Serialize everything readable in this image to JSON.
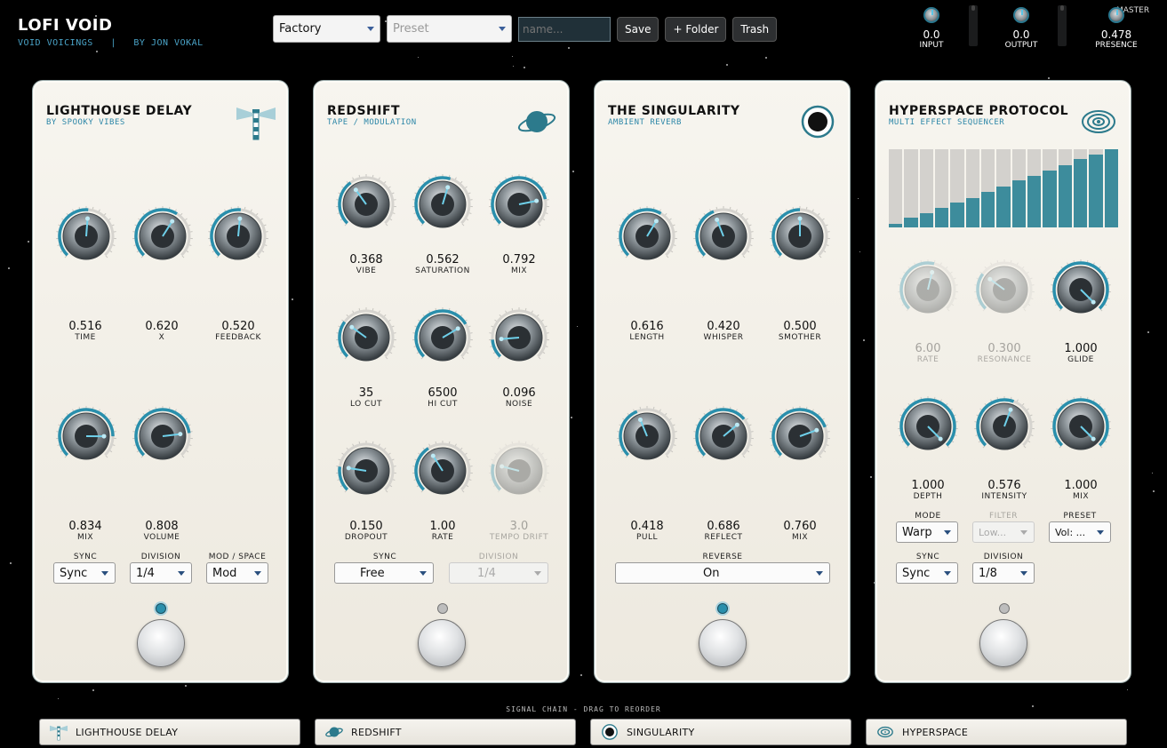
{
  "app": {
    "title": "LOFI VOID",
    "subtitle": "VOID VOICINGS   |   BY JON VOKAL"
  },
  "toolbar": {
    "bank": "Factory",
    "preset_placeholder": "Preset",
    "name_placeholder": "name...",
    "save": "Save",
    "folder": "+ Folder",
    "trash": "Trash"
  },
  "meters": {
    "input": {
      "value": "0.0",
      "label": "INPUT"
    },
    "output": {
      "value": "0.0",
      "label": "OUTPUT"
    },
    "presence": {
      "value": "0.478",
      "label": "PRESENCE"
    },
    "master_label": "MASTER"
  },
  "pedals": [
    {
      "title": "LIGHTHOUSE DELAY",
      "subtitle": "BY SPOOKY VIBES",
      "knobs": [
        {
          "value": "0.516",
          "label": "TIME",
          "level": 0.516
        },
        {
          "value": "0.620",
          "label": "X",
          "level": 0.62
        },
        {
          "value": "0.520",
          "label": "FEEDBACK",
          "level": 0.52
        },
        {
          "value": "0.834",
          "label": "MIX",
          "level": 0.834
        },
        {
          "value": "0.808",
          "label": "VOLUME",
          "level": 0.808
        }
      ],
      "dropdowns": [
        {
          "label": "SYNC",
          "value": "Sync"
        },
        {
          "label": "DIVISION",
          "value": "1/4"
        },
        {
          "label": "MOD / SPACE",
          "value": "Mod"
        }
      ],
      "active": true
    },
    {
      "title": "REDSHIFT",
      "subtitle": "TAPE / MODULATION",
      "knobs": [
        {
          "value": "0.368",
          "label": "VIBE",
          "level": 0.368
        },
        {
          "value": "0.562",
          "label": "SATURATION",
          "level": 0.562
        },
        {
          "value": "0.792",
          "label": "MIX",
          "level": 0.792
        },
        {
          "value": "35",
          "label": "LO CUT",
          "level": 0.3
        },
        {
          "value": "6500",
          "label": "HI CUT",
          "level": 0.72
        },
        {
          "value": "0.096",
          "label": "NOISE",
          "level": 0.15
        },
        {
          "value": "0.150",
          "label": "DROPOUT",
          "level": 0.2
        },
        {
          "value": "1.00",
          "label": "RATE",
          "level": 0.38
        },
        {
          "value": "3.0",
          "label": "TEMPO DRIFT",
          "level": 0.22
        }
      ],
      "dropdowns": [
        {
          "label": "SYNC",
          "value": "Free"
        },
        {
          "label": "DIVISION",
          "value": "1/4"
        }
      ],
      "active": false
    },
    {
      "title": "THE SINGULARITY",
      "subtitle": "AMBIENT REVERB",
      "knobs": [
        {
          "value": "0.616",
          "label": "LENGTH",
          "level": 0.616
        },
        {
          "value": "0.420",
          "label": "WHISPER",
          "level": 0.42
        },
        {
          "value": "0.500",
          "label": "SMOTHER",
          "level": 0.5
        },
        {
          "value": "0.418",
          "label": "PULL",
          "level": 0.418
        },
        {
          "value": "0.686",
          "label": "REFLECT",
          "level": 0.686
        },
        {
          "value": "0.760",
          "label": "MIX",
          "level": 0.76
        }
      ],
      "dropdowns": [
        {
          "label": "REVERSE",
          "value": "On"
        }
      ],
      "active": true
    },
    {
      "title": "HYPERSPACE PROTOCOL",
      "subtitle": "MULTI EFFECT SEQUENCER",
      "sequencer": [
        0.05,
        0.12,
        0.18,
        0.25,
        0.32,
        0.38,
        0.45,
        0.52,
        0.6,
        0.66,
        0.73,
        0.8,
        0.87,
        0.93,
        1.0
      ],
      "knobs": [
        {
          "value": "6.00",
          "label": "RATE",
          "level": 0.55
        },
        {
          "value": "0.300",
          "label": "RESONANCE",
          "level": 0.3
        },
        {
          "value": "1.000",
          "label": "GLIDE",
          "level": 1.0
        },
        {
          "value": "1.000",
          "label": "DEPTH",
          "level": 1.0
        },
        {
          "value": "0.576",
          "label": "INTENSITY",
          "level": 0.576
        },
        {
          "value": "1.000",
          "label": "MIX",
          "level": 1.0
        }
      ],
      "dropdowns": [
        {
          "label": "MODE",
          "value": "Warp"
        },
        {
          "label": "FILTER",
          "value": "Low..."
        },
        {
          "label": "PRESET",
          "value": "Vol: ..."
        },
        {
          "label": "SYNC",
          "value": "Sync"
        },
        {
          "label": "DIVISION",
          "value": "1/8"
        }
      ],
      "active": false
    }
  ],
  "chain": {
    "label": "SIGNAL CHAIN  -  DRAG TO REORDER",
    "items": [
      "LIGHTHOUSE DELAY",
      "REDSHIFT",
      "SINGULARITY",
      "HYPERSPACE"
    ]
  },
  "colors": {
    "accent": "#2a8fac",
    "panel": "#f3f1eb",
    "background": "#000000"
  }
}
